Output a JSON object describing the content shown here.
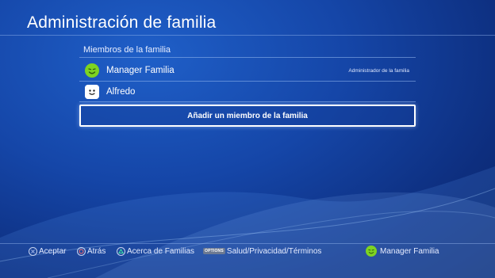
{
  "page": {
    "title": "Administración de familia"
  },
  "family": {
    "section_label": "Miembros de la familia",
    "members": [
      {
        "name": "Manager Familia",
        "role": "Administrador de la familia",
        "avatar_icon": "green-smiley-icon",
        "avatar_color": "#7ed321"
      },
      {
        "name": "Alfredo",
        "role": "",
        "avatar_icon": "white-face-icon",
        "avatar_color": "#ffffff"
      }
    ],
    "add_member_label": "Añadir un miembro de la familia"
  },
  "footer": {
    "hints": [
      {
        "label": "Aceptar",
        "icon": "cross-button-icon"
      },
      {
        "label": "Atrás",
        "icon": "circle-button-icon"
      },
      {
        "label": "Acerca de Familias",
        "icon": "triangle-button-icon"
      },
      {
        "label": "Salud/Privacidad/Términos",
        "icon": "options-button-icon",
        "chip_text": "OPTIONS"
      }
    ],
    "current_user": "Manager Familia"
  },
  "colors": {
    "background": "#1546a8",
    "accent": "#ffffff",
    "smiley": "#7ed321"
  }
}
